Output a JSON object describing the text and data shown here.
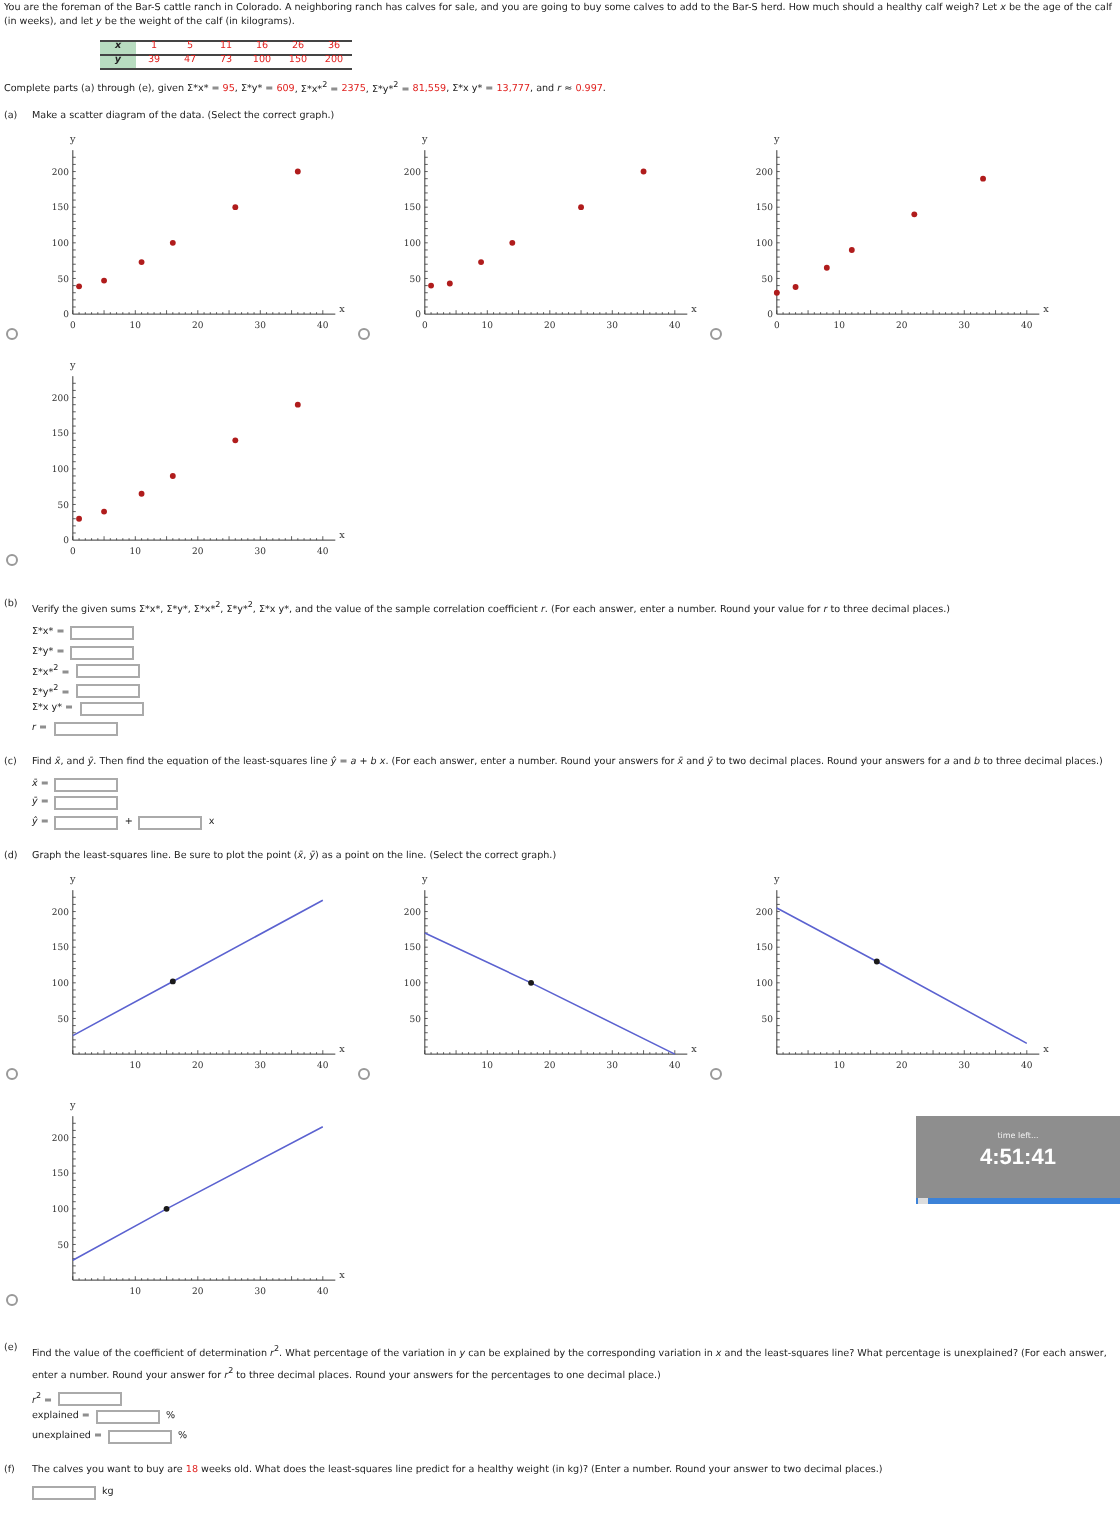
{
  "intro": "You are the foreman of the Bar-S cattle ranch in Colorado. A neighboring ranch has calves for sale, and you are going to buy some calves to add to the Bar-S herd. How much should a healthy calf weigh? Let *x* be the age of the calf (in weeks), and let *y* be the weight of the calf (in kilograms).",
  "table": {
    "rows": [
      {
        "label": "x",
        "values": [
          "1",
          "5",
          "11",
          "16",
          "26",
          "36"
        ]
      },
      {
        "label": "y",
        "values": [
          "39",
          "47",
          "73",
          "100",
          "150",
          "200"
        ]
      }
    ]
  },
  "given": [
    {
      "text": "Complete parts (a) through (e), given Σ*x* = ",
      "highlight": false
    },
    {
      "text": "95",
      "highlight": true
    },
    {
      "text": ", Σ*y* = ",
      "highlight": false
    },
    {
      "text": "609",
      "highlight": true
    },
    {
      "text": ", Σ*x*$^{2}$ = ",
      "highlight": false
    },
    {
      "text": "2375",
      "highlight": true
    },
    {
      "text": ", Σ*y*$^{2}$ = ",
      "highlight": false
    },
    {
      "text": "81,559",
      "highlight": true
    },
    {
      "text": ", Σ*x y* = ",
      "highlight": false
    },
    {
      "text": "13,777",
      "highlight": true
    },
    {
      "text": ", and *r* ≈ ",
      "highlight": false
    },
    {
      "text": "0.997",
      "highlight": true
    },
    {
      "text": ".",
      "highlight": false
    }
  ],
  "sections": [
    {
      "label": "(a)",
      "kind": "graphs",
      "text": [
        {
          "text": "Make a scatter diagram of the data. (Select the correct graph.)",
          "highlight": false
        }
      ],
      "graphs": [
        {
          "selected": false,
          "chart_data": {
            "type": "scatter",
            "xlabel": "x",
            "ylabel": "y",
            "xlim": [
              0,
              42
            ],
            "ylim": [
              0,
              230
            ],
            "xticks": [
              {
                "value": 0,
                "label": "0"
              },
              {
                "value": 10,
                "label": "10"
              },
              {
                "value": 20,
                "label": "20"
              },
              {
                "value": 30,
                "label": "30"
              },
              {
                "value": 40,
                "label": "40"
              }
            ],
            "yticks": [
              {
                "value": 0,
                "label": "0"
              },
              {
                "value": 50,
                "label": "50"
              },
              {
                "value": 100,
                "label": "100"
              },
              {
                "value": 150,
                "label": "150"
              },
              {
                "value": 200,
                "label": "200"
              }
            ],
            "x": [
              1,
              5,
              11,
              16,
              26,
              36
            ],
            "series": [
              {
                "color": "#b01c1c",
                "values": [
                  39,
                  47,
                  73,
                  100,
                  150,
                  200
                ]
              }
            ]
          }
        },
        {
          "selected": false,
          "chart_data": {
            "type": "scatter",
            "xlabel": "x",
            "ylabel": "y",
            "xlim": [
              0,
              42
            ],
            "ylim": [
              0,
              230
            ],
            "xticks": [
              {
                "value": 0,
                "label": "0"
              },
              {
                "value": 10,
                "label": "10"
              },
              {
                "value": 20,
                "label": "20"
              },
              {
                "value": 30,
                "label": "30"
              },
              {
                "value": 40,
                "label": "40"
              }
            ],
            "yticks": [
              {
                "value": 0,
                "label": "0"
              },
              {
                "value": 50,
                "label": "50"
              },
              {
                "value": 100,
                "label": "100"
              },
              {
                "value": 150,
                "label": "150"
              },
              {
                "value": 200,
                "label": "200"
              }
            ],
            "x": [
              1,
              4,
              9,
              14,
              25,
              35
            ],
            "series": [
              {
                "color": "#b01c1c",
                "values": [
                  40,
                  43,
                  73,
                  100,
                  150,
                  200
                ]
              }
            ]
          }
        },
        {
          "selected": false,
          "chart_data": {
            "type": "scatter",
            "xlabel": "x",
            "ylabel": "y",
            "xlim": [
              0,
              42
            ],
            "ylim": [
              0,
              230
            ],
            "xticks": [
              {
                "value": 0,
                "label": "0"
              },
              {
                "value": 10,
                "label": "10"
              },
              {
                "value": 20,
                "label": "20"
              },
              {
                "value": 30,
                "label": "30"
              },
              {
                "value": 40,
                "label": "40"
              }
            ],
            "yticks": [
              {
                "value": 0,
                "label": "0"
              },
              {
                "value": 50,
                "label": "50"
              },
              {
                "value": 100,
                "label": "100"
              },
              {
                "value": 150,
                "label": "150"
              },
              {
                "value": 200,
                "label": "200"
              }
            ],
            "x": [
              0,
              3,
              8,
              12,
              22,
              33
            ],
            "series": [
              {
                "color": "#b01c1c",
                "values": [
                  30,
                  38,
                  65,
                  90,
                  140,
                  190
                ]
              }
            ]
          }
        },
        {
          "selected": false,
          "chart_data": {
            "type": "scatter",
            "xlabel": "x",
            "ylabel": "y",
            "xlim": [
              0,
              42
            ],
            "ylim": [
              0,
              230
            ],
            "xticks": [
              {
                "value": 0,
                "label": "0"
              },
              {
                "value": 10,
                "label": "10"
              },
              {
                "value": 20,
                "label": "20"
              },
              {
                "value": 30,
                "label": "30"
              },
              {
                "value": 40,
                "label": "40"
              }
            ],
            "yticks": [
              {
                "value": 0,
                "label": "0"
              },
              {
                "value": 50,
                "label": "50"
              },
              {
                "value": 100,
                "label": "100"
              },
              {
                "value": 150,
                "label": "150"
              },
              {
                "value": 200,
                "label": "200"
              }
            ],
            "x": [
              1,
              5,
              11,
              16,
              26,
              36
            ],
            "series": [
              {
                "color": "#b01c1c",
                "values": [
                  30,
                  40,
                  65,
                  90,
                  140,
                  190
                ]
              }
            ]
          }
        }
      ]
    },
    {
      "label": "(b)",
      "kind": "fields",
      "text": [
        {
          "text": "Verify the given sums Σ*x*, Σ*y*, Σ*x*$^{2}$, Σ*y*$^{2}$, Σ*x y*, and the value of the sample correlation coefficient *r*. (For each answer, enter a number. Round your value for *r* to three decimal places.)",
          "highlight": false
        }
      ],
      "fields": [
        {
          "items": [
            {
              "kind": "label",
              "text": "Σ*x* ="
            },
            {
              "kind": "input"
            }
          ]
        },
        {
          "items": [
            {
              "kind": "label",
              "text": "Σ*y* ="
            },
            {
              "kind": "input"
            }
          ]
        },
        {
          "items": [
            {
              "kind": "label",
              "text": "Σ*x*$^{2}$ ="
            },
            {
              "kind": "input"
            }
          ]
        },
        {
          "items": [
            {
              "kind": "label",
              "text": "Σ*y*$^{2}$ ="
            },
            {
              "kind": "input"
            }
          ]
        },
        {
          "items": [
            {
              "kind": "label",
              "text": "Σ*x y* ="
            },
            {
              "kind": "input"
            }
          ]
        },
        {
          "items": [
            {
              "kind": "label",
              "text": "*r* ="
            },
            {
              "kind": "input"
            }
          ]
        }
      ]
    },
    {
      "label": "(c)",
      "kind": "fields",
      "text": [
        {
          "text": "Find *x̄*, and *ȳ*. Then find the equation of the least-squares line *ŷ* = *a* + *b x*. (For each answer, enter a number. Round your answers for *x̄* and *ȳ* to two decimal places. Round your answers for *a* and *b* to three decimal places.)",
          "highlight": false
        }
      ],
      "fields": [
        {
          "items": [
            {
              "kind": "label",
              "text": "*x̄* ="
            },
            {
              "kind": "input"
            }
          ]
        },
        {
          "items": [
            {
              "kind": "label",
              "text": "*ȳ* ="
            },
            {
              "kind": "input"
            }
          ]
        },
        {
          "items": [
            {
              "kind": "label",
              "text": "*ŷ* ="
            },
            {
              "kind": "input"
            },
            {
              "kind": "text",
              "text": "+"
            },
            {
              "kind": "input"
            },
            {
              "kind": "text",
              "text": "x"
            }
          ]
        }
      ]
    },
    {
      "label": "(d)",
      "kind": "graphs",
      "text": [
        {
          "text": "Graph the least-squares line. Be sure to plot the point (*x̄*, *ȳ*) as a point on the line. (Select the correct graph.)",
          "highlight": false
        }
      ],
      "graphs": [
        {
          "selected": false,
          "chart_data": {
            "type": "line",
            "xlabel": "x",
            "ylabel": "y",
            "xlim": [
              0,
              42
            ],
            "ylim": [
              0,
              230
            ],
            "xticks": [
              {
                "value": 10,
                "label": "10"
              },
              {
                "value": 20,
                "label": "20"
              },
              {
                "value": 30,
                "label": "30"
              },
              {
                "value": 40,
                "label": "40"
              }
            ],
            "yticks": [
              {
                "value": 50,
                "label": "50"
              },
              {
                "value": 100,
                "label": "100"
              },
              {
                "value": 150,
                "label": "150"
              },
              {
                "value": 200,
                "label": "200"
              }
            ],
            "x": [
              0,
              16,
              40
            ],
            "series": [
              {
                "color": "#5b62d0",
                "values": [
                  26,
                  102,
                  216
                ]
              },
              {
                "color": "#1a1a1a",
                "marker": "circle",
                "values": [
                  null,
                  102,
                  null
                ]
              }
            ]
          }
        },
        {
          "selected": false,
          "chart_data": {
            "type": "line",
            "xlabel": "x",
            "ylabel": "y",
            "xlim": [
              0,
              42
            ],
            "ylim": [
              0,
              230
            ],
            "xticks": [
              {
                "value": 10,
                "label": "10"
              },
              {
                "value": 20,
                "label": "20"
              },
              {
                "value": 30,
                "label": "30"
              },
              {
                "value": 40,
                "label": "40"
              }
            ],
            "yticks": [
              {
                "value": 50,
                "label": "50"
              },
              {
                "value": 100,
                "label": "100"
              },
              {
                "value": 150,
                "label": "150"
              },
              {
                "value": 200,
                "label": "200"
              }
            ],
            "x": [
              0,
              17,
              40
            ],
            "series": [
              {
                "color": "#5b62d0",
                "values": [
                  170,
                  100,
                  0
                ]
              },
              {
                "color": "#1a1a1a",
                "marker": "circle",
                "values": [
                  null,
                  100,
                  null
                ]
              }
            ]
          }
        },
        {
          "selected": false,
          "chart_data": {
            "type": "line",
            "xlabel": "x",
            "ylabel": "y",
            "xlim": [
              0,
              42
            ],
            "ylim": [
              0,
              230
            ],
            "xticks": [
              {
                "value": 10,
                "label": "10"
              },
              {
                "value": 20,
                "label": "20"
              },
              {
                "value": 30,
                "label": "30"
              },
              {
                "value": 40,
                "label": "40"
              }
            ],
            "yticks": [
              {
                "value": 50,
                "label": "50"
              },
              {
                "value": 100,
                "label": "100"
              },
              {
                "value": 150,
                "label": "150"
              },
              {
                "value": 200,
                "label": "200"
              }
            ],
            "x": [
              0,
              16,
              40
            ],
            "series": [
              {
                "color": "#5b62d0",
                "values": [
                  205,
                  130,
                  15
                ]
              },
              {
                "color": "#1a1a1a",
                "marker": "circle",
                "values": [
                  null,
                  130,
                  null
                ]
              }
            ]
          }
        },
        {
          "selected": false,
          "chart_data": {
            "type": "line",
            "xlabel": "x",
            "ylabel": "y",
            "xlim": [
              0,
              42
            ],
            "ylim": [
              0,
              230
            ],
            "xticks": [
              {
                "value": 10,
                "label": "10"
              },
              {
                "value": 20,
                "label": "20"
              },
              {
                "value": 30,
                "label": "30"
              },
              {
                "value": 40,
                "label": "40"
              }
            ],
            "yticks": [
              {
                "value": 50,
                "label": "50"
              },
              {
                "value": 100,
                "label": "100"
              },
              {
                "value": 150,
                "label": "150"
              },
              {
                "value": 200,
                "label": "200"
              }
            ],
            "x": [
              0,
              15,
              40
            ],
            "series": [
              {
                "color": "#5b62d0",
                "values": [
                  28,
                  100,
                  215
                ]
              },
              {
                "color": "#1a1a1a",
                "marker": "circle",
                "values": [
                  null,
                  100,
                  null
                ]
              }
            ]
          }
        }
      ]
    },
    {
      "label": "(e)",
      "kind": "fields",
      "text": [
        {
          "text": "Find the value of the coefficient of determination *r*$^{2}$. What percentage of the variation in *y* can be explained by the corresponding variation in *x* and the least-squares line? What percentage is unexplained? (For each answer, enter a number. Round your answer for *r*$^{2}$ to three decimal places. Round your answers for the percentages to one decimal place.)",
          "highlight": false
        }
      ],
      "fields": [
        {
          "items": [
            {
              "kind": "label",
              "text": "*r*$^{2}$ ="
            },
            {
              "kind": "input"
            }
          ]
        },
        {
          "items": [
            {
              "kind": "label",
              "text": "explained ="
            },
            {
              "kind": "input"
            },
            {
              "kind": "text",
              "text": "%"
            }
          ]
        },
        {
          "items": [
            {
              "kind": "label",
              "text": "unexplained ="
            },
            {
              "kind": "input"
            },
            {
              "kind": "text",
              "text": "%"
            }
          ]
        }
      ]
    },
    {
      "label": "(f)",
      "kind": "fields",
      "text": [
        {
          "text": "The calves you want to buy are ",
          "highlight": false
        },
        {
          "text": "18",
          "highlight": true
        },
        {
          "text": " weeks old. What does the least-squares line predict for a healthy weight (in kg)? (Enter a number. Round your answer to two decimal places.)",
          "highlight": false
        }
      ],
      "fields": [
        {
          "items": [
            {
              "kind": "input"
            },
            {
              "kind": "text",
              "text": "kg"
            }
          ]
        }
      ]
    }
  ],
  "timer": {
    "label": "time left...",
    "value": "4:51:41"
  }
}
